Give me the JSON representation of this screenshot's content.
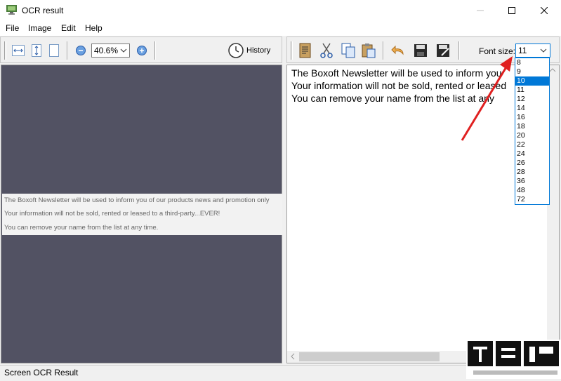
{
  "window": {
    "title": "OCR result"
  },
  "menu": {
    "items": [
      "File",
      "Image",
      "Edit",
      "Help"
    ]
  },
  "left_toolbar": {
    "zoom_value": "40.6%",
    "history_label": "History"
  },
  "image_text_lines": [
    "The Boxoft Newsletter will be used to inform you of our products news and promotion only",
    "Your information will not be sold, rented or leased to a third-party...EVER!",
    "You can remove your name from the list at any time."
  ],
  "right_toolbar": {
    "font_size_label": "Font size:",
    "font_size_value": "11"
  },
  "text_lines": [
    "The Boxoft Newsletter will be used to inform you",
    "Your information will not be sold, rented or leased",
    "You can remove your name from the list at any"
  ],
  "font_size_options": [
    "8",
    "9",
    "10",
    "11",
    "12",
    "14",
    "16",
    "18",
    "20",
    "22",
    "24",
    "26",
    "28",
    "36",
    "48",
    "72"
  ],
  "font_size_highlighted": "10",
  "status": {
    "text": "Screen OCR Result"
  },
  "colors": {
    "accent": "#0078d7",
    "image_bg": "#525263",
    "arrow": "#e02020"
  }
}
